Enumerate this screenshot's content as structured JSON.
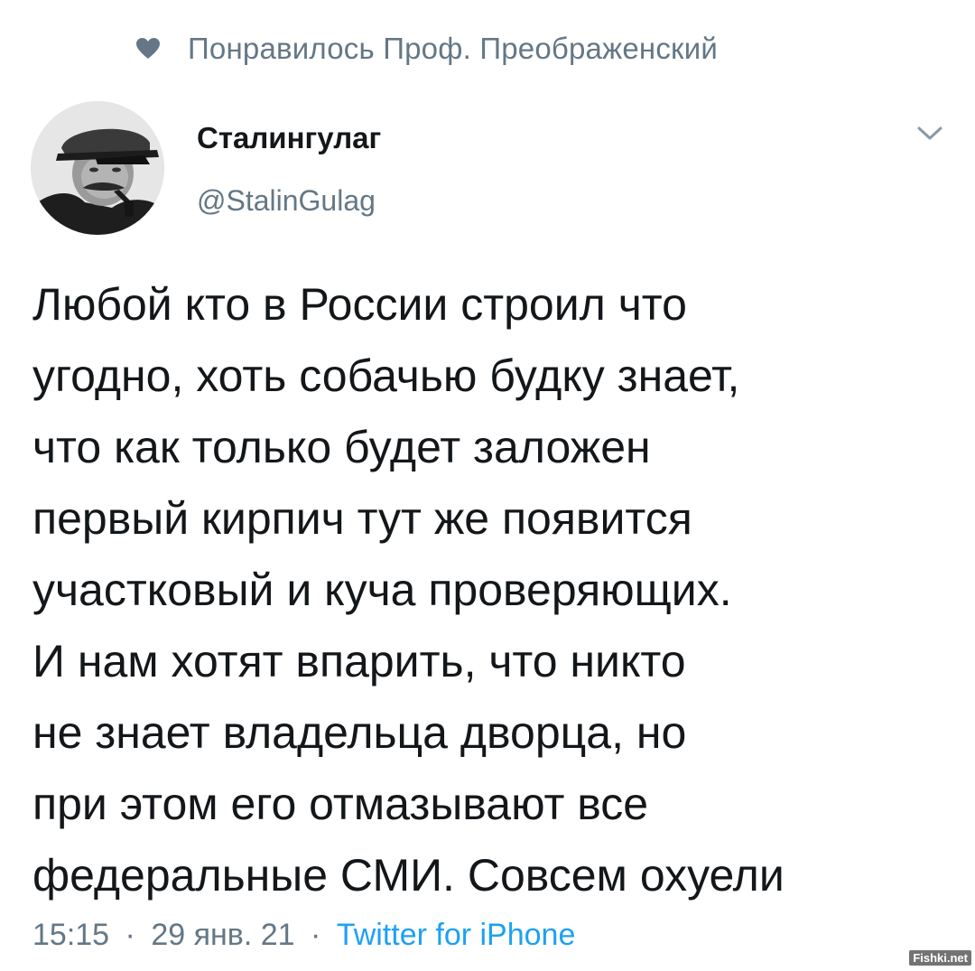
{
  "social_context": {
    "icon": "heart-icon",
    "text": "Понравилось Проф. Преображенский"
  },
  "author": {
    "display_name": "Сталингулаг",
    "handle": "@StalinGulag",
    "avatar_icon": "avatar-portrait"
  },
  "tweet": {
    "lines": [
      "Любой кто в России строил что",
      "угодно, хоть собачью будку знает,",
      "что как только будет заложен",
      "первый кирпич тут же появится",
      "участковый и куча проверяющих.",
      "И нам хотят впарить, что никто",
      "не знает владельца дворца, но",
      "при этом его отмазывают все",
      "федеральные СМИ. Совсем охуели"
    ]
  },
  "meta": {
    "time": "15:15",
    "date": "29 янв. 21",
    "separator": "·",
    "source": "Twitter for iPhone"
  },
  "watermark": "Fishki.net",
  "colors": {
    "text": "#14171a",
    "secondary": "#657786",
    "link": "#1da1f2"
  }
}
